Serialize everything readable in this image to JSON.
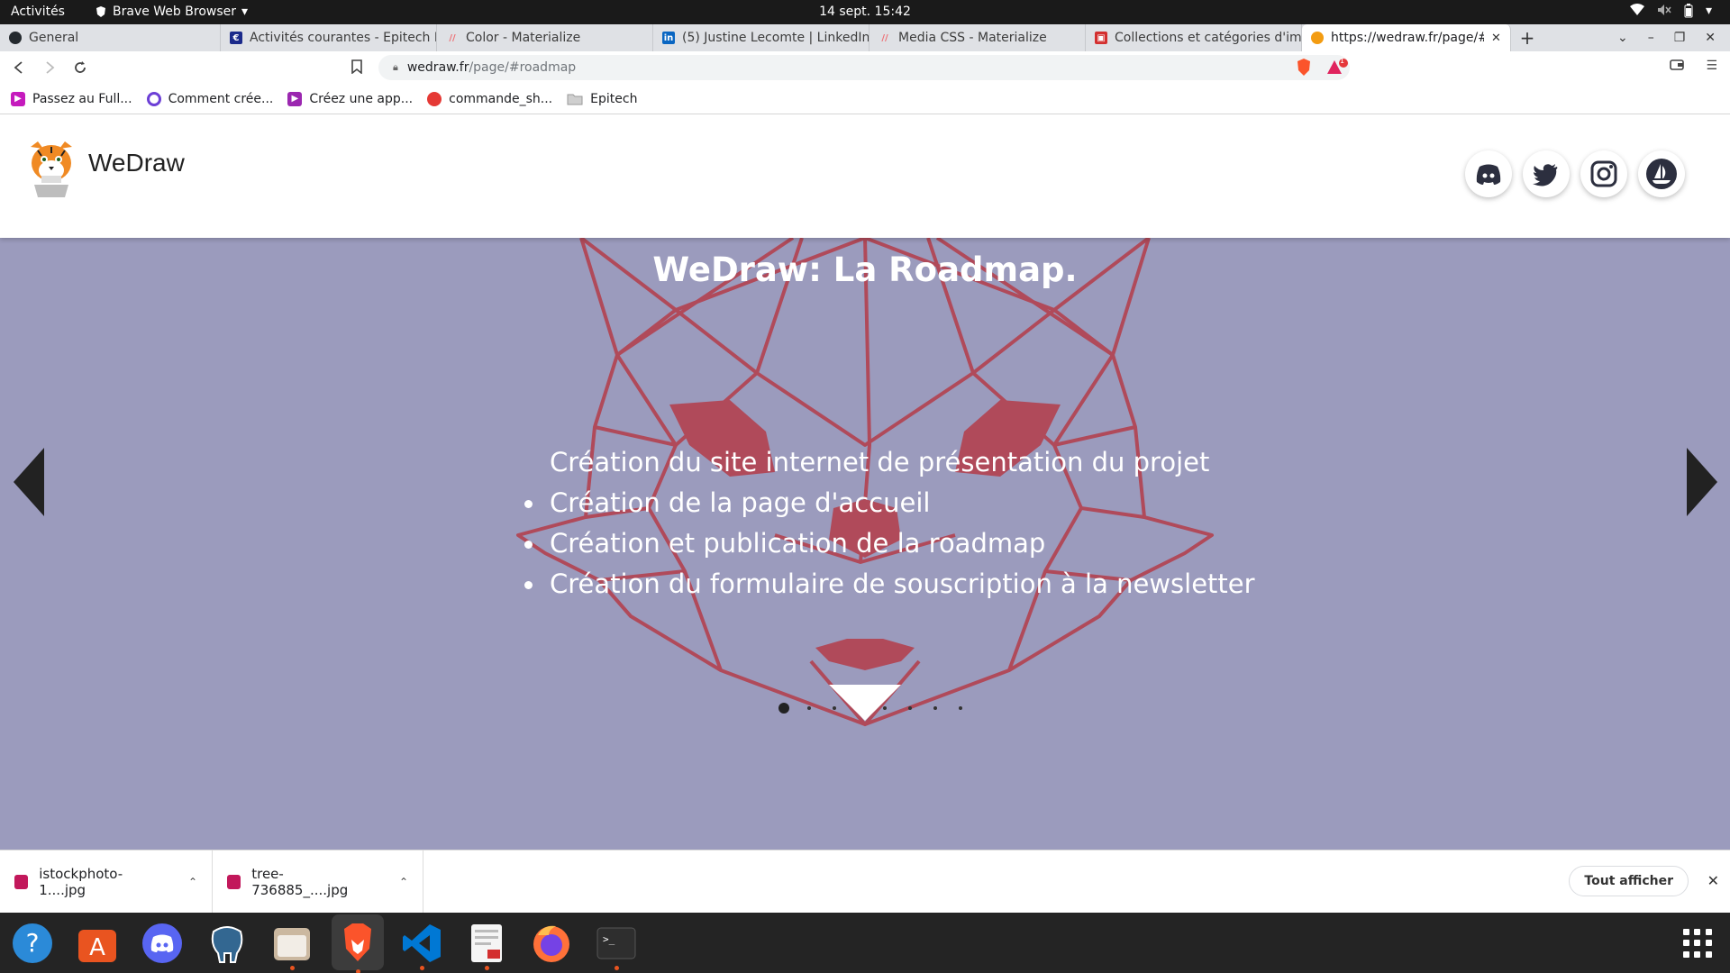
{
  "system_bar": {
    "activities": "Activités",
    "app_name": "Brave Web Browser",
    "clock": "14 sept.  15:42"
  },
  "tabs": [
    {
      "label": "General",
      "icon": "github-icon",
      "color": "#24292e"
    },
    {
      "label": "Activités courantes - Epitech Intranet",
      "icon": "epitech-icon",
      "color": "#1b2a8b"
    },
    {
      "label": "Color - Materialize",
      "icon": "materialize-icon",
      "color": "#ee6e73"
    },
    {
      "label": "(5) Justine Lecomte | LinkedIn",
      "icon": "linkedin-icon",
      "color": "#0a66c2"
    },
    {
      "label": "Media CSS - Materialize",
      "icon": "materialize-icon",
      "color": "#ee6e73"
    },
    {
      "label": "Collections et catégories d'images",
      "icon": "collection-icon",
      "color": "#d32f2f"
    },
    {
      "label": "https://wedraw.fr/page/#roadmap",
      "icon": "wedraw-icon",
      "color": "#f39c12"
    }
  ],
  "toolbar": {
    "url_host": "wedraw.fr",
    "url_path": "/page/#roadmap",
    "alert_count": "1"
  },
  "bookmarks": [
    {
      "label": "Passez au Full...",
      "color": "#c51bbd"
    },
    {
      "label": "Comment crée...",
      "color": "#6c3fd6"
    },
    {
      "label": "Créez une app...",
      "color": "#9b27b0"
    },
    {
      "label": "commande_sh...",
      "color": "#e53935"
    },
    {
      "label": "Epitech",
      "color": "#cfcfcf"
    }
  ],
  "site": {
    "brand": "WeDraw",
    "hero_title": "WeDraw: La Roadmap.",
    "roadmap_items": [
      "Création du site internet de présentation du projet",
      "Création de la page d'accueil",
      "Création et publication de la roadmap",
      "Création du formulaire de souscription à la newsletter"
    ],
    "carousel_slides": 8,
    "carousel_active": 1,
    "hero_bg": "#9b9bbd",
    "fox_color": "#b04a5a"
  },
  "downloads": {
    "files": [
      "istockphoto-1....jpg",
      "tree-736885_....jpg"
    ],
    "show_all": "Tout afficher"
  },
  "dock": [
    "help",
    "app-center",
    "discord",
    "pgadmin",
    "files",
    "brave",
    "vscode",
    "text-editor",
    "firefox",
    "terminal"
  ]
}
